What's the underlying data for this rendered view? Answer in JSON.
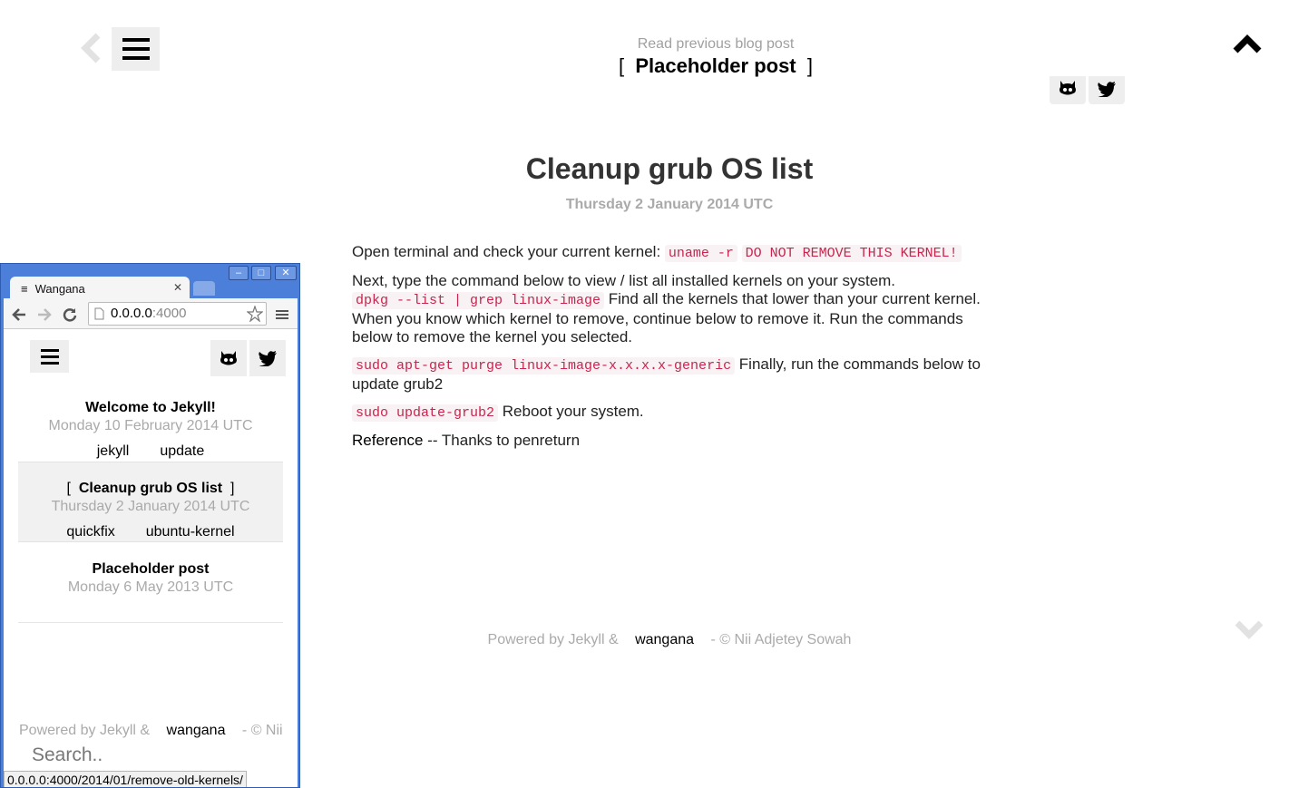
{
  "nav": {
    "prev_label": "Read previous blog post",
    "prev_title": "Placeholder post",
    "bracket_open": "[",
    "bracket_close": "]"
  },
  "post": {
    "title": "Cleanup grub OS list",
    "date": "Thursday 2 January 2014 UTC",
    "p1_text": "Open terminal and check your current kernel: ",
    "p1_code1": "uname -r",
    "p1_code2": "DO NOT REMOVE THIS KERNEL!",
    "p2_text1": "Next, type the command below to view / list all installed kernels on your system.",
    "p2_code": "dpkg --list | grep linux-image",
    "p2_text2": " Find all the kernels that lower than your current kernel. When you know which kernel to remove, continue below to remove it. Run the commands below to remove the kernel you selected.",
    "p3_code": "sudo apt-get purge linux-image-x.x.x.x-generic",
    "p3_text": " Finally, run the commands below to update grub2",
    "p4_code": "sudo update-grub2",
    "p4_text": " Reboot your system.",
    "ref_link": "Reference",
    "ref_text": " -- Thanks to penreturn"
  },
  "footer": {
    "powered": "Powered by Jekyll &",
    "theme_link": "wangana",
    "copyright": "- © Nii Adjetey Sowah"
  },
  "mini_browser": {
    "tab_title": "Wangana",
    "address_host": "0.0.0.0",
    "address_port": ":4000",
    "posts": [
      {
        "title": "Welcome to Jekyll!",
        "date": "Monday 10 February 2014 UTC",
        "tags": [
          "jekyll",
          "update"
        ]
      },
      {
        "title": "Cleanup grub OS list",
        "date": "Thursday 2 January 2014 UTC",
        "tags": [
          "quickfix",
          "ubuntu-kernel"
        ]
      },
      {
        "title": "Placeholder post",
        "date": "Monday 6 May 2013 UTC",
        "tags": []
      }
    ],
    "footer_powered": "Powered by Jekyll &",
    "footer_theme": "wangana",
    "footer_copy": "- © Nii",
    "search_placeholder": "Search..",
    "status_url": "0.0.0.0:4000/2014/01/remove-old-kernels/"
  },
  "icons": [
    "chevron-left-icon",
    "hamburger-menu-icon",
    "chevron-up-icon",
    "github-icon",
    "twitter-icon",
    "chevron-down-icon"
  ],
  "colors": {
    "code_text": "#c7254e",
    "code_bg": "#f9f2f4",
    "muted": "#aaaaaa",
    "window_frame": "#4c7fd9"
  }
}
